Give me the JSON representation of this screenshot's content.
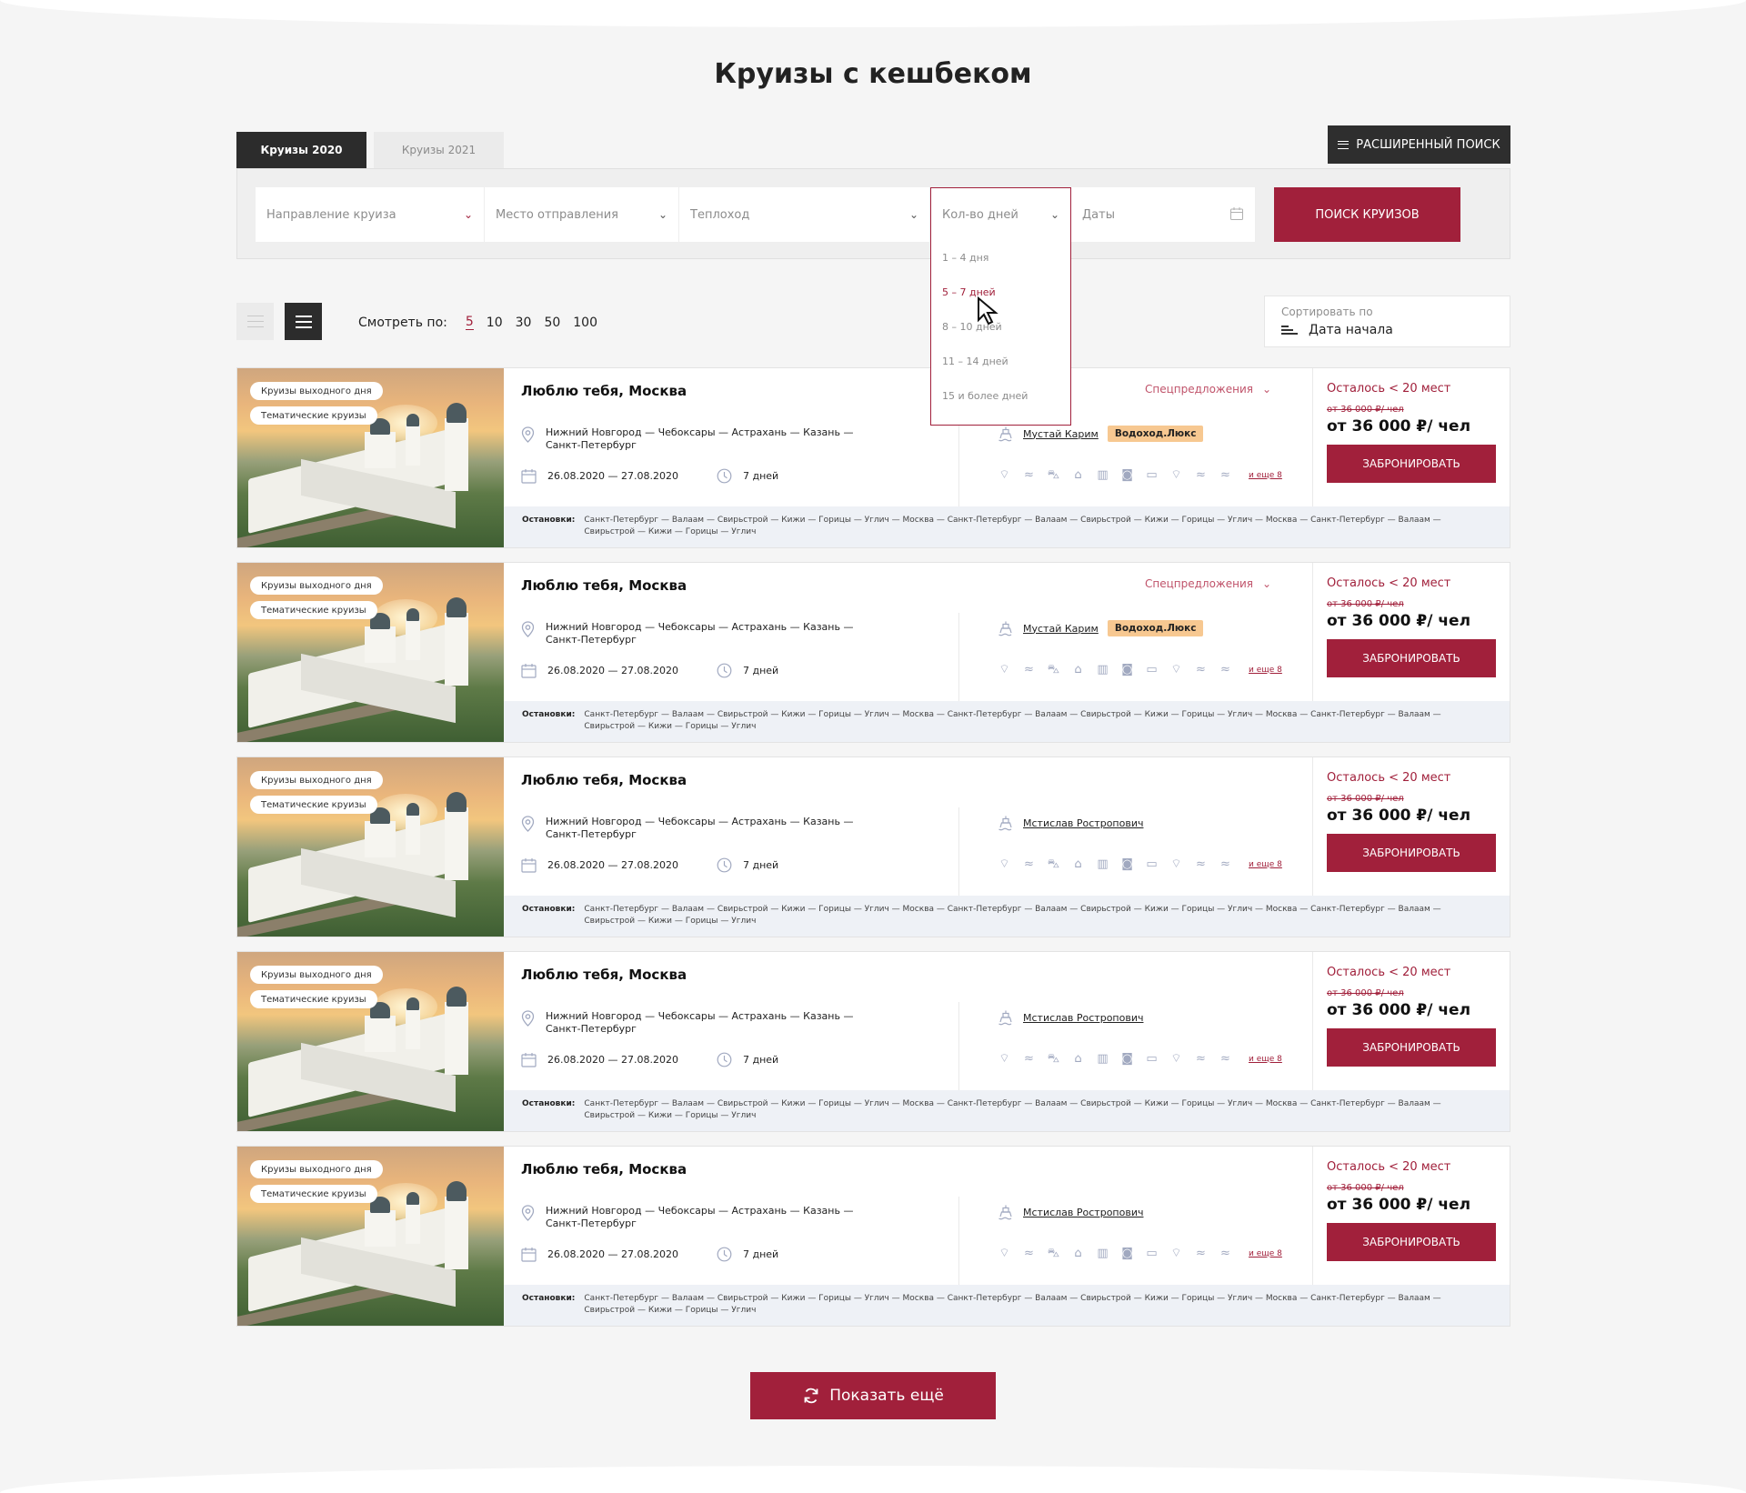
{
  "page": {
    "title": "Круизы с кешбеком"
  },
  "tabs": [
    {
      "label": "Круизы 2020"
    },
    {
      "label": "Круизы 2021"
    }
  ],
  "advanced_search": {
    "label": "РАСШИРЕННЫЙ ПОИСК"
  },
  "filters": {
    "direction": {
      "placeholder": "Направление круиза"
    },
    "departure": {
      "placeholder": "Место отправления"
    },
    "ship": {
      "placeholder": "Теплоход"
    },
    "days": {
      "placeholder": "Кол-во дней"
    },
    "dates": {
      "placeholder": "Даты"
    },
    "search_button": "ПОИСК КРУИЗОВ"
  },
  "days_dropdown": {
    "options": [
      "1 – 4 дня",
      "5 – 7 дней",
      "8 – 10 дней",
      "11 – 14 дней",
      "15 и более дней"
    ],
    "hovered": "5 – 7 дней"
  },
  "view": {
    "per_page_label": "Смотреть по:",
    "per_page_options": [
      "5",
      "10",
      "30",
      "50",
      "100"
    ],
    "per_page_selected": "5"
  },
  "sort": {
    "label": "Сортировать по",
    "value": "Дата начала"
  },
  "cards": [
    {
      "badge1": "Круизы выходного дня",
      "badge2": "Тематические круизы",
      "title": "Люблю тебя, Москва",
      "route": "Нижний Новгород — Чебоксары — Астрахань — Казань — Санкт-Петербург",
      "dates": "26.08.2020 — 27.08.2020",
      "duration": "7 дней",
      "special": "Спецпредложения",
      "ship_name": "Мустай Карим",
      "ship_class": "Водоход.Люкс",
      "more_amenities": "и еще 8",
      "seats_left": "Осталось < 20 мест",
      "old_price": "от 36 000 ₽/ чел",
      "price": "от 36 000 ₽/ чел",
      "book": "ЗАБРОНИРОВАТЬ",
      "stops_label": "Остановки:",
      "stops": "Санкт-Петербург — Валаам — Свирьстрой — Кижи — Горицы — Углич — Москва — Санкт-Петербург — Валаам — Свирьстрой — Кижи — Горицы — Углич — Москва — Санкт-Петербург — Валаам — Свирьстрой — Кижи — Горицы — Углич"
    },
    {
      "badge1": "Круизы выходного дня",
      "badge2": "Тематические круизы",
      "title": "Люблю тебя, Москва",
      "route": "Нижний Новгород — Чебоксары — Астрахань — Казань — Санкт-Петербург",
      "dates": "26.08.2020 — 27.08.2020",
      "duration": "7 дней",
      "special": "Спецпредложения",
      "ship_name": "Мустай Карим",
      "ship_class": "Водоход.Люкс",
      "more_amenities": "и еще 8",
      "seats_left": "Осталось < 20 мест",
      "old_price": "от 36 000 ₽/ чел",
      "price": "от 36 000 ₽/ чел",
      "book": "ЗАБРОНИРОВАТЬ",
      "stops_label": "Остановки:",
      "stops": "Санкт-Петербург — Валаам — Свирьстрой — Кижи — Горицы — Углич — Москва — Санкт-Петербург — Валаам — Свирьстрой — Кижи — Горицы — Углич — Москва — Санкт-Петербург — Валаам — Свирьстрой — Кижи — Горицы — Углич"
    },
    {
      "badge1": "Круизы выходного дня",
      "badge2": "Тематические круизы",
      "title": "Люблю тебя, Москва",
      "route": "Нижний Новгород — Чебоксары — Астрахань — Казань — Санкт-Петербург",
      "dates": "26.08.2020 — 27.08.2020",
      "duration": "7 дней",
      "special": "",
      "ship_name": "Мстислав Ростропович",
      "ship_class": "",
      "more_amenities": "и еще 8",
      "seats_left": "Осталось < 20 мест",
      "old_price": "от 36 000 ₽/ чел",
      "price": "от 36 000 ₽/ чел",
      "book": "ЗАБРОНИРОВАТЬ",
      "stops_label": "Остановки:",
      "stops": "Санкт-Петербург — Валаам — Свирьстрой — Кижи — Горицы — Углич — Москва — Санкт-Петербург — Валаам — Свирьстрой — Кижи — Горицы — Углич — Москва — Санкт-Петербург — Валаам — Свирьстрой — Кижи — Горицы — Углич"
    },
    {
      "badge1": "Круизы выходного дня",
      "badge2": "Тематические круизы",
      "title": "Люблю тебя, Москва",
      "route": "Нижний Новгород — Чебоксары — Астрахань — Казань — Санкт-Петербург",
      "dates": "26.08.2020 — 27.08.2020",
      "duration": "7 дней",
      "special": "",
      "ship_name": "Мстислав Ростропович",
      "ship_class": "",
      "more_amenities": "и еще 8",
      "seats_left": "Осталось < 20 мест",
      "old_price": "от 36 000 ₽/ чел",
      "price": "от 36 000 ₽/ чел",
      "book": "ЗАБРОНИРОВАТЬ",
      "stops_label": "Остановки:",
      "stops": "Санкт-Петербург — Валаам — Свирьстрой — Кижи — Горицы — Углич — Москва — Санкт-Петербург — Валаам — Свирьстрой — Кижи — Горицы — Углич — Москва — Санкт-Петербург — Валаам — Свирьстрой — Кижи — Горицы — Углич"
    },
    {
      "badge1": "Круизы выходного дня",
      "badge2": "Тематические круизы",
      "title": "Люблю тебя, Москва",
      "route": "Нижний Новгород — Чебоксары — Астрахань — Казань — Санкт-Петербург",
      "dates": "26.08.2020 — 27.08.2020",
      "duration": "7 дней",
      "special": "",
      "ship_name": "Мстислав Ростропович",
      "ship_class": "",
      "more_amenities": "и еще 8",
      "seats_left": "Осталось < 20 мест",
      "old_price": "от 36 000 ₽/ чел",
      "price": "от 36 000 ₽/ чел",
      "book": "ЗАБРОНИРОВАТЬ",
      "stops_label": "Остановки:",
      "stops": "Санкт-Петербург — Валаам — Свирьстрой — Кижи — Горицы — Углич — Москва — Санкт-Петербург — Валаам — Свирьстрой — Кижи — Горицы — Углич — Москва — Санкт-Петербург — Валаам — Свирьстрой — Кижи — Горицы — Углич"
    }
  ],
  "amenity_icons": [
    "wifi-icon",
    "pool-icon",
    "car-icon",
    "heart-house-icon",
    "buildings-icon",
    "camera-icon",
    "bus-icon",
    "wifi-icon",
    "pool-icon",
    "pool-icon"
  ],
  "show_more": {
    "label": "Показать ещё"
  },
  "colors": {
    "accent": "#a1203b",
    "dark": "#2c2c2c",
    "ship_class_bg": "#f7c891",
    "stops_bg": "#eef1f6"
  }
}
